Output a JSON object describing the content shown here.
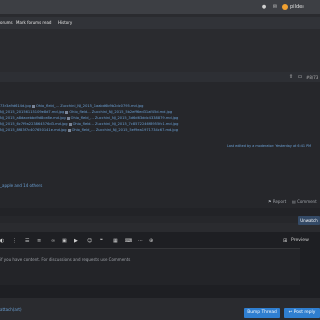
{
  "header": {
    "username": "pilde"
  },
  "nav": {
    "items": [
      "orums",
      "Mark forums read",
      "History"
    ]
  },
  "post": {
    "index_text": "#8/73",
    "attachments": [
      {
        "text": "73r3a9d614d.jpg",
        "image": "Ohio_fleld_...",
        "file": "Zucchini_NJ_2015_1aabd6b9b2dc0795.md.jpg"
      },
      {
        "text": "NJ_2015_20156115109e8d7.md.jpg",
        "image": "Ohio_fleld...",
        "file": "Zucchini_NJ_2015_5b2eff6ed31af45d.md.jpg"
      },
      {
        "text": "NJ_2015_a8dacebbd9d8ce8e.md.jpg",
        "image": "Ohio_fleld_...",
        "file": "Zucchini_NJ_2015_3d6d63ddc4338879.md.jpg"
      },
      {
        "text": "NJ_2015_6c7f9a223864576d3.md.jpg",
        "image": "Ohio_fleld...",
        "file": "Zucchini_NJ_2015_7c8572246f8955fc1.md.jpg"
      },
      {
        "text": "NJ_2015_8f83f7c407650141e.md.jpg",
        "image": "Ohio_fleld_...",
        "file": "Zucchini_NJ_2015_5ef9ea1971734c67.md.jpg"
      }
    ],
    "last_edited": "Last edited by a moderator: Yesterday at 6:41 PM",
    "likes_text": "_apple and 14 others",
    "actions": {
      "report": "Report",
      "comment": "Comment"
    }
  },
  "unwatch_label": "Unwatch",
  "editor": {
    "placeholder": "if you have content. For discussions and requests use Comments",
    "preview": "Preview"
  },
  "footer": {
    "attach_label": "attach(art)",
    "bump": "Bump Thread",
    "post_reply": "Post reply"
  },
  "colors": {
    "accent": "#2f7fd1",
    "link": "#6ba1d6",
    "avatar": "#f0a030"
  }
}
